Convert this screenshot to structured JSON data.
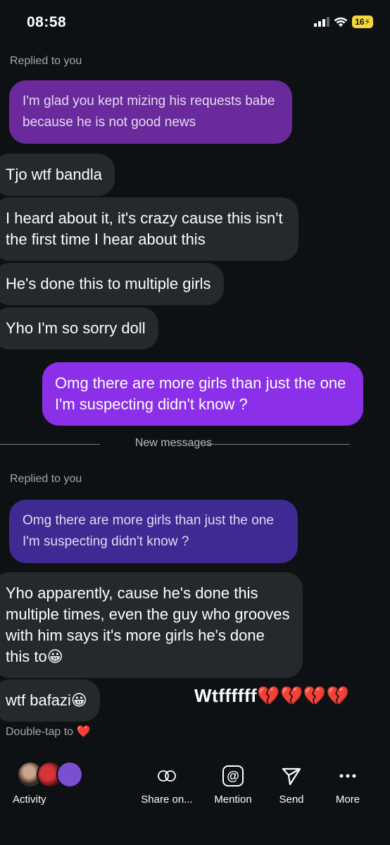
{
  "status_bar": {
    "time": "08:58",
    "battery": "16"
  },
  "chat": {
    "replied_label_1": "Replied to you",
    "quoted_1": "I'm glad you kept mizing his requests babe because he is not good news",
    "messages_1": [
      "Tjo wtf bandla",
      "I heard about it, it's crazy cause this isn't the first time I hear about this",
      "He's done this to multiple girls",
      "Yho I'm so sorry doll"
    ],
    "sent_message": "Omg there are more girls than just the one I'm suspecting didn't know ?",
    "divider": "New messages",
    "replied_label_2": "Replied to you",
    "quoted_2": "Omg there are more girls than just the one I'm suspecting didn't know ?",
    "long_message": "Yho apparently, cause he's done this multiple times, even the guy who grooves with him says it's more girls he's done this to😀",
    "short_message": "wtf bafazi😀",
    "overlay_text": "Wtffffff💔💔💔💔",
    "double_tap_hint": "Double-tap to ❤️"
  },
  "toolbar": {
    "activity": "Activity",
    "share": "Share on...",
    "mention": "Mention",
    "send": "Send",
    "more": "More"
  },
  "colors": {
    "background": "#0d1114",
    "received_bubble": "#26292c",
    "quoted_bubble_1": "#6a2a9c",
    "quoted_bubble_2": "#3f2a93",
    "sent_bubble": "#8b30e8"
  }
}
